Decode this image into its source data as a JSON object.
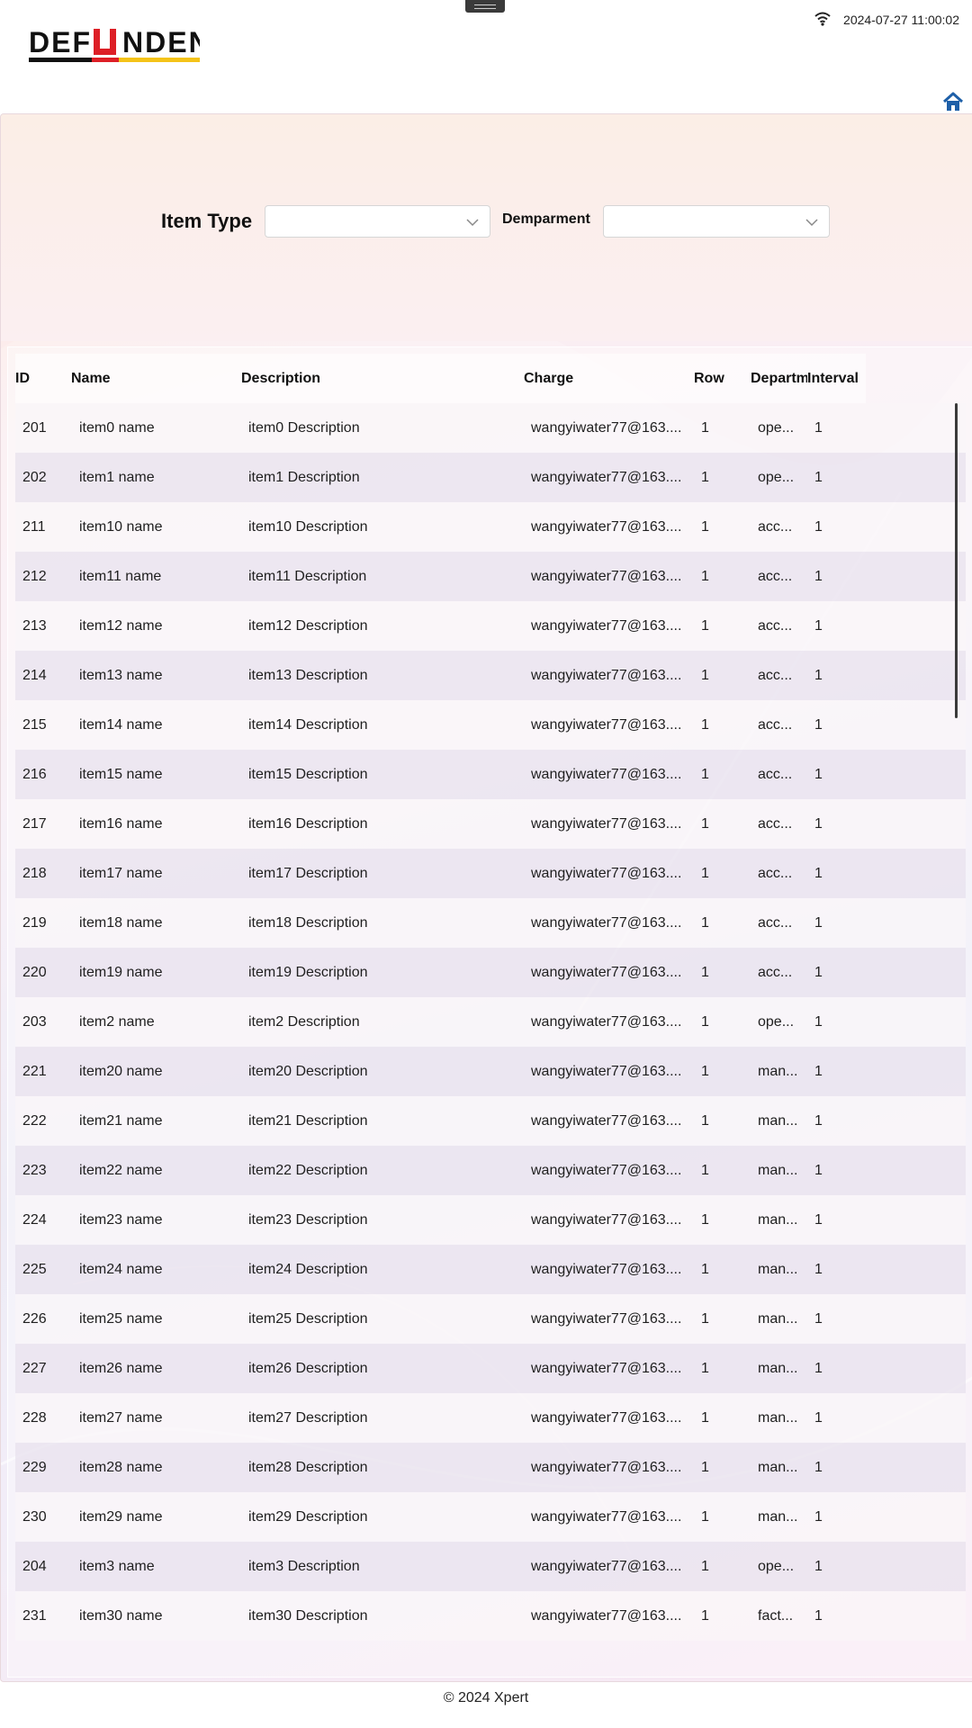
{
  "brand": {
    "logo_text": "DEF  NDEN"
  },
  "status_bar": {
    "datetime": "2024-07-27 11:00:02",
    "wifi_icon": "wifi-icon"
  },
  "nav": {
    "home_icon": "home-icon"
  },
  "filters": {
    "item_type_label": "Item Type",
    "item_type_value": "",
    "department_label": "Demparment",
    "department_value": ""
  },
  "table": {
    "columns": [
      "ID",
      "Name",
      "Description",
      "Charge",
      "Row",
      "Departm",
      "Interval"
    ],
    "rows": [
      [
        "201",
        "item0 name",
        "item0 Description",
        "wangyiwater77@163....",
        "1",
        "ope...",
        "1"
      ],
      [
        "202",
        "item1 name",
        "item1 Description",
        "wangyiwater77@163....",
        "1",
        "ope...",
        "1"
      ],
      [
        "211",
        "item10 name",
        "item10 Description",
        "wangyiwater77@163....",
        "1",
        "acc...",
        "1"
      ],
      [
        "212",
        "item11 name",
        "item11 Description",
        "wangyiwater77@163....",
        "1",
        "acc...",
        "1"
      ],
      [
        "213",
        "item12 name",
        "item12 Description",
        "wangyiwater77@163....",
        "1",
        "acc...",
        "1"
      ],
      [
        "214",
        "item13 name",
        "item13 Description",
        "wangyiwater77@163....",
        "1",
        "acc...",
        "1"
      ],
      [
        "215",
        "item14 name",
        "item14 Description",
        "wangyiwater77@163....",
        "1",
        "acc...",
        "1"
      ],
      [
        "216",
        "item15 name",
        "item15 Description",
        "wangyiwater77@163....",
        "1",
        "acc...",
        "1"
      ],
      [
        "217",
        "item16 name",
        "item16 Description",
        "wangyiwater77@163....",
        "1",
        "acc...",
        "1"
      ],
      [
        "218",
        "item17 name",
        "item17 Description",
        "wangyiwater77@163....",
        "1",
        "acc...",
        "1"
      ],
      [
        "219",
        "item18 name",
        "item18 Description",
        "wangyiwater77@163....",
        "1",
        "acc...",
        "1"
      ],
      [
        "220",
        "item19 name",
        "item19 Description",
        "wangyiwater77@163....",
        "1",
        "acc...",
        "1"
      ],
      [
        "203",
        "item2 name",
        "item2 Description",
        "wangyiwater77@163....",
        "1",
        "ope...",
        "1"
      ],
      [
        "221",
        "item20 name",
        "item20 Description",
        "wangyiwater77@163....",
        "1",
        "man...",
        "1"
      ],
      [
        "222",
        "item21 name",
        "item21 Description",
        "wangyiwater77@163....",
        "1",
        "man...",
        "1"
      ],
      [
        "223",
        "item22 name",
        "item22 Description",
        "wangyiwater77@163....",
        "1",
        "man...",
        "1"
      ],
      [
        "224",
        "item23 name",
        "item23 Description",
        "wangyiwater77@163....",
        "1",
        "man...",
        "1"
      ],
      [
        "225",
        "item24 name",
        "item24 Description",
        "wangyiwater77@163....",
        "1",
        "man...",
        "1"
      ],
      [
        "226",
        "item25 name",
        "item25 Description",
        "wangyiwater77@163....",
        "1",
        "man...",
        "1"
      ],
      [
        "227",
        "item26 name",
        "item26 Description",
        "wangyiwater77@163....",
        "1",
        "man...",
        "1"
      ],
      [
        "228",
        "item27 name",
        "item27 Description",
        "wangyiwater77@163....",
        "1",
        "man...",
        "1"
      ],
      [
        "229",
        "item28 name",
        "item28 Description",
        "wangyiwater77@163....",
        "1",
        "man...",
        "1"
      ],
      [
        "230",
        "item29 name",
        "item29 Description",
        "wangyiwater77@163....",
        "1",
        "man...",
        "1"
      ],
      [
        "204",
        "item3 name",
        "item3 Description",
        "wangyiwater77@163....",
        "1",
        "ope...",
        "1"
      ],
      [
        "231",
        "item30 name",
        "item30 Description",
        "wangyiwater77@163....",
        "1",
        "fact...",
        "1"
      ]
    ]
  },
  "footer": {
    "copyright": "© 2024 Xpert"
  },
  "colors": {
    "logo_red": "#dd1f26",
    "logo_yellow": "#f4c319",
    "home_blue": "#1d5fa8"
  }
}
